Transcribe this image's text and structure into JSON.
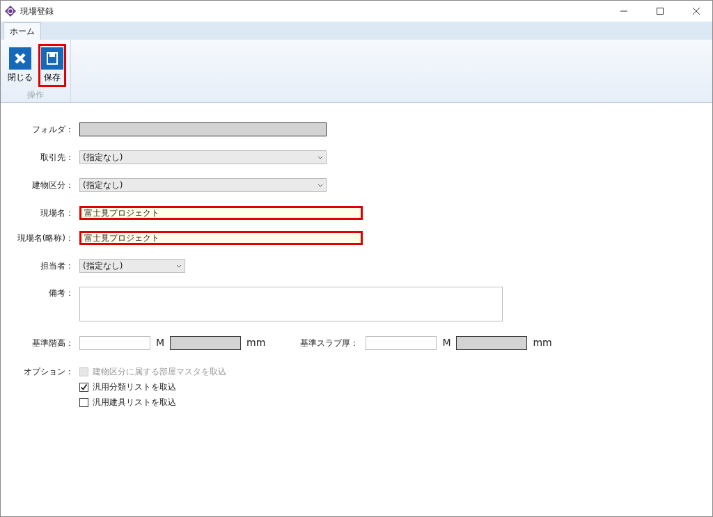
{
  "window": {
    "title": "現場登録"
  },
  "tabs": [
    {
      "label": "ホーム",
      "selected": true
    }
  ],
  "ribbon": {
    "group_label": "操作",
    "buttons": [
      {
        "label": "閉じる",
        "kind": "close",
        "highlighted": false
      },
      {
        "label": "保存",
        "kind": "save",
        "highlighted": true
      }
    ]
  },
  "fields": [
    {
      "label": "フォルダ：",
      "kind": "readonly",
      "highlighted": false
    },
    {
      "label": "取引先：",
      "kind": "select",
      "value": "(指定なし)",
      "highlighted": false
    },
    {
      "label": "建物区分：",
      "kind": "select",
      "value": "(指定なし)",
      "highlighted": false
    },
    {
      "label": "現場名：",
      "kind": "text",
      "value": "富士見プロジェクト",
      "highlighted": true
    },
    {
      "label": "現場名(略称)：",
      "kind": "text",
      "value": "富士見プロジェクト",
      "highlighted": true
    },
    {
      "label": "担当者：",
      "kind": "select",
      "value": "(指定なし)",
      "highlighted": false
    },
    {
      "label": "備考：",
      "kind": "textarea",
      "highlighted": false
    }
  ],
  "measurements": [
    {
      "label": "基準階高：",
      "unit_m": "M",
      "unit_mm": "mm"
    },
    {
      "label": "基準スラブ厚：",
      "unit_m": "M",
      "unit_mm": "mm"
    }
  ],
  "options": {
    "label": "オプション：",
    "items": [
      {
        "label": "建物区分に属する部屋マスタを取込",
        "checked": false,
        "disabled": true
      },
      {
        "label": "汎用分類リストを取込",
        "checked": true,
        "disabled": false
      },
      {
        "label": "汎用建具リストを取込",
        "checked": false,
        "disabled": false
      }
    ]
  }
}
